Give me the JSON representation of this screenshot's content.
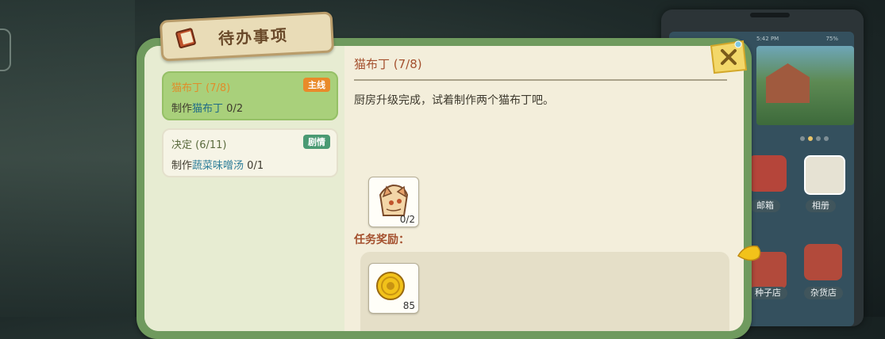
{
  "window": {
    "title": "待办事项"
  },
  "quests": [
    {
      "title": "猫布丁 (7/8)",
      "desc_prefix": "制作",
      "desc_item": "猫布丁",
      "desc_count": "0/2",
      "badge": "主线",
      "active": true
    },
    {
      "title": "决定 (6/11)",
      "desc_prefix": "制作",
      "desc_item": "蔬菜味噌汤",
      "desc_count": "0/1",
      "badge": "剧情",
      "active": false
    }
  ],
  "detail": {
    "title": "猫布丁 (7/8)",
    "description": "厨房升级完成，试着制作两个猫布丁吧。",
    "required_item": {
      "icon": "cat-pudding-icon",
      "count": "0/2"
    },
    "reward_label": "任务奖励：",
    "reward_item": {
      "icon": "gold-coin-icon",
      "count": "85"
    }
  },
  "phone": {
    "status_time": "5:42 PM",
    "status_battery": "75%",
    "apps": [
      {
        "label": "邮箱",
        "icon": "mailbox-icon"
      },
      {
        "label": "相册",
        "icon": "album-icon"
      },
      {
        "label": "种子店",
        "icon": "seed-shop-icon"
      },
      {
        "label": "杂货店",
        "icon": "grocery-store-icon"
      }
    ]
  },
  "colors": {
    "panel_green": "#6f9a5e",
    "active_card": "#a9d07b",
    "main_badge": "#e98a2a",
    "story_badge": "#4a9a73",
    "title_text": "#a4502e"
  }
}
